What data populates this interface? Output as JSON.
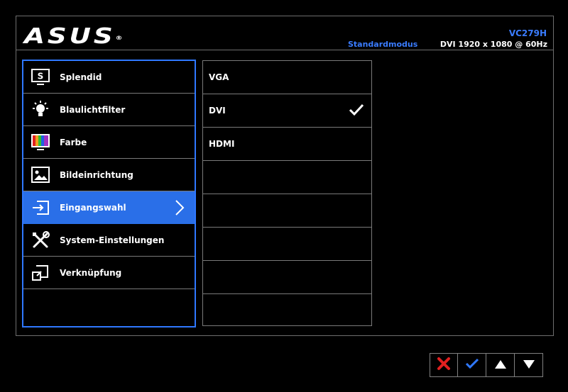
{
  "header": {
    "brand": "ASUS",
    "brand_mark": "®",
    "model": "VC279H",
    "mode": "Standardmodus",
    "signal": "DVI 1920 x 1080 @ 60Hz",
    "accent_color": "#3a7cff"
  },
  "main_menu": {
    "items": [
      {
        "label": "Splendid",
        "icon": "splendid-icon"
      },
      {
        "label": "Blaulichtfilter",
        "icon": "bluelight-filter-icon"
      },
      {
        "label": "Farbe",
        "icon": "color-icon"
      },
      {
        "label": "Bildeinrichtung",
        "icon": "image-setup-icon"
      },
      {
        "label": "Eingangswahl",
        "icon": "input-select-icon",
        "selected": true
      },
      {
        "label": "System-Einstellungen",
        "icon": "system-settings-icon"
      },
      {
        "label": "Verknüpfung",
        "icon": "shortcut-icon"
      }
    ],
    "highlight_color": "#2a6fe8"
  },
  "sub_menu": {
    "items": [
      {
        "label": "VGA",
        "checked": false
      },
      {
        "label": "DVI",
        "checked": true
      },
      {
        "label": "HDMI",
        "checked": false
      },
      {
        "label": ""
      },
      {
        "label": ""
      },
      {
        "label": ""
      },
      {
        "label": ""
      },
      {
        "label": ""
      }
    ]
  },
  "nav_buttons": [
    {
      "icon": "close-icon",
      "color": "#e02020"
    },
    {
      "icon": "confirm-check-icon",
      "color": "#2f78ff"
    },
    {
      "icon": "arrow-up-icon",
      "color": "#ffffff"
    },
    {
      "icon": "arrow-down-icon",
      "color": "#ffffff"
    }
  ]
}
